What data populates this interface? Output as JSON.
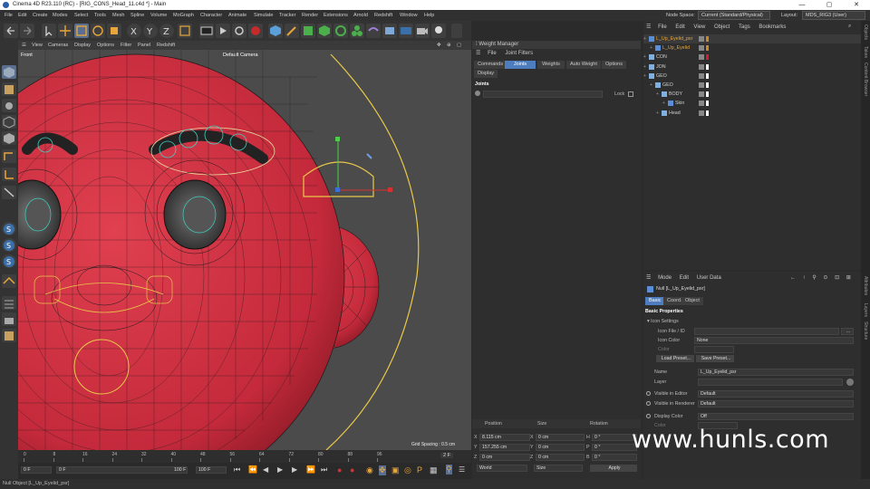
{
  "window": {
    "title": "Cinema 4D R23.110 (RC) - [RIG_CONS_Head_11.c4d *] - Main",
    "controls": [
      "—",
      "▢",
      "✕"
    ]
  },
  "menubar": {
    "items": [
      "File",
      "Edit",
      "Create",
      "Modes",
      "Select",
      "Tools",
      "Mesh",
      "Spline",
      "Volume",
      "MoGraph",
      "Character",
      "Animate",
      "Simulate",
      "Tracker",
      "Render",
      "Extensions",
      "Arnold",
      "Redshift",
      "Window",
      "Help"
    ],
    "node_space_label": "Node Space:",
    "node_space_value": "Current (Standard/Physical)",
    "layout_label": "Layout:",
    "layout_value": "MDS_RIG3 (User)"
  },
  "viewport": {
    "menu": [
      "View",
      "Cameras",
      "Display",
      "Options",
      "Filter",
      "Panel",
      "Redshift"
    ],
    "view_name": "Front",
    "camera_name": "Default Camera",
    "grid_spacing": "Grid Spacing : 0.5 cm"
  },
  "timeline": {
    "ticks": [
      "0",
      "8",
      "16",
      "24",
      "32",
      "40",
      "48",
      "56",
      "64",
      "72",
      "80",
      "88",
      "96"
    ],
    "current_frame": "2 F"
  },
  "playbar": {
    "start_frame": "0 F",
    "min_frame": "0 F",
    "end_frame": "100 F",
    "max_frame": "100 F"
  },
  "status": {
    "text": "Null Object [L_Up_Eyelid_psr]"
  },
  "weight_manager": {
    "title": "Weight Manager",
    "menu": [
      "File",
      "Joint Filters"
    ],
    "tabs": [
      "Commands",
      "Joints",
      "Weights",
      "Auto Weight",
      "Options"
    ],
    "active_tab": "Joints",
    "sub_tab": "Display",
    "section": "Joints",
    "lock_label": "Lock"
  },
  "coordinates": {
    "headers": [
      "Position",
      "Size",
      "Rotation"
    ],
    "rows": [
      {
        "axis": "X",
        "pos": "8.115 cm",
        "size_axis": "X",
        "size": "0 cm",
        "rot_axis": "H",
        "rot": "0 °"
      },
      {
        "axis": "Y",
        "pos": "157.255 cm",
        "size_axis": "Y",
        "size": "0 cm",
        "rot_axis": "P",
        "rot": "0 °"
      },
      {
        "axis": "Z",
        "pos": "0 cm",
        "size_axis": "Z",
        "size": "0 cm",
        "rot_axis": "B",
        "rot": "0 °"
      }
    ],
    "mode": "World",
    "size_mode": "Size",
    "apply_label": "Apply"
  },
  "object_manager": {
    "menu": [
      "File",
      "Edit",
      "View",
      "Object",
      "Tags",
      "Bookmarks"
    ],
    "objects": [
      {
        "name": "L_Up_Eyelid_psr",
        "indent": 0,
        "color": "#e8a53a",
        "dot": "#c9882f"
      },
      {
        "name": "L_Up_Eyelid",
        "indent": 1,
        "color": "#e8a53a",
        "dot": "#c9882f"
      },
      {
        "name": "CON",
        "indent": 0,
        "color": "#d0d0d0",
        "dot": "#d02030"
      },
      {
        "name": "JON",
        "indent": 0,
        "color": "#d0d0d0",
        "dot": "#ffffff"
      },
      {
        "name": "GEO",
        "indent": 0,
        "color": "#d0d0d0",
        "dot": "#ffffff"
      },
      {
        "name": "GEO",
        "indent": 1,
        "color": "#d0d0d0",
        "dot": "#ffffff"
      },
      {
        "name": "BODY",
        "indent": 2,
        "color": "#d0d0d0",
        "dot": "#ffffff"
      },
      {
        "name": "Skin",
        "indent": 3,
        "color": "#d0d0d0",
        "dot": "#ffffff"
      },
      {
        "name": "Head",
        "indent": 2,
        "color": "#d0d0d0",
        "dot": "#ffffff"
      }
    ]
  },
  "attributes": {
    "menu": [
      "Mode",
      "Edit",
      "User Data"
    ],
    "object_title": "Null [L_Up_Eyelid_psr]",
    "tabs": [
      "Basic",
      "Coord.",
      "Object"
    ],
    "active_tab": "Basic",
    "section": "Basic Properties",
    "icon_settings": "Icon Settings",
    "fields": {
      "icon_file_label": "Icon File / ID",
      "icon_color_label": "Icon Color",
      "icon_color_value": "None",
      "color_label": "Color",
      "load_preset": "Load Preset...",
      "save_preset": "Save Preset...",
      "name_label": "Name",
      "name_value": "L_Up_Eyelid_psr",
      "layer_label": "Layer",
      "visible_editor_label": "Visible in Editor",
      "visible_editor_value": "Default",
      "visible_renderer_label": "Visible in Renderer",
      "visible_renderer_value": "Default",
      "display_color_label": "Display Color",
      "display_color_value": "Off",
      "color2_label": "Color"
    }
  },
  "right_strip": [
    "Objects",
    "Takes",
    "Content Browser",
    "Attributes",
    "Layers",
    "Structure"
  ],
  "watermark": "www.hunls.com",
  "colors": {
    "accent_blue": "#4d7dbf",
    "head_red": "#d42c3e",
    "wire": "#1a1a1a",
    "spline_yellow": "#e8c84a"
  }
}
